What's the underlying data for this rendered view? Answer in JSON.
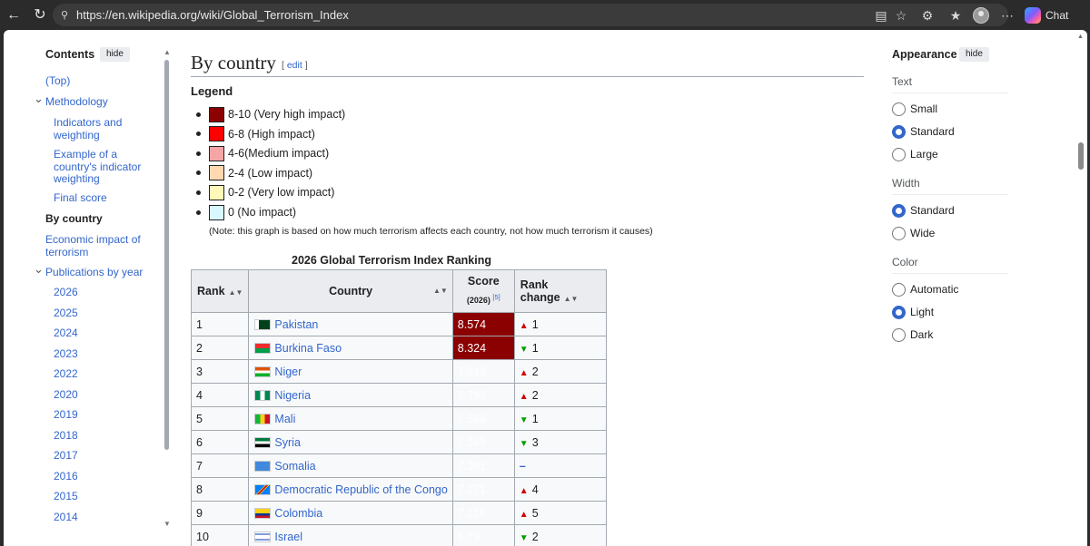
{
  "browser": {
    "url": "https://en.wikipedia.org/wiki/Global_Terrorism_Index",
    "chat_label": "Chat"
  },
  "toc": {
    "title": "Contents",
    "hide_label": "hide",
    "items": [
      {
        "label": "(Top)",
        "level": 1
      },
      {
        "label": "Methodology",
        "level": 1,
        "expandable": true
      },
      {
        "label": "Indicators and weighting",
        "level": 2
      },
      {
        "label": "Example of a country's indicator weighting",
        "level": 2
      },
      {
        "label": "Final score",
        "level": 2
      },
      {
        "label": "By country",
        "level": 1,
        "active": true
      },
      {
        "label": "Economic impact of terrorism",
        "level": 1
      },
      {
        "label": "Publications by year",
        "level": 1,
        "expandable": true
      },
      {
        "label": "2026",
        "level": 2
      },
      {
        "label": "2025",
        "level": 2
      },
      {
        "label": "2024",
        "level": 2
      },
      {
        "label": "2023",
        "level": 2
      },
      {
        "label": "2022",
        "level": 2
      },
      {
        "label": "2020",
        "level": 2
      },
      {
        "label": "2019",
        "level": 2
      },
      {
        "label": "2018",
        "level": 2
      },
      {
        "label": "2017",
        "level": 2
      },
      {
        "label": "2016",
        "level": 2
      },
      {
        "label": "2015",
        "level": 2
      },
      {
        "label": "2014",
        "level": 2
      }
    ]
  },
  "section": {
    "heading": "By country",
    "edit_open": "[ ",
    "edit_label": "edit",
    "edit_close": " ]",
    "legend_title": "Legend",
    "legend": [
      {
        "label": "8-10 (Very high impact)",
        "color": "#8b0000"
      },
      {
        "label": "6-8 (High impact)",
        "color": "#ff0000"
      },
      {
        "label": "4-6(Medium impact)",
        "color": "#f4a6a6"
      },
      {
        "label": "2-4 (Low impact)",
        "color": "#ffd8b0"
      },
      {
        "label": "0-2 (Very low impact)",
        "color": "#fff8b8"
      },
      {
        "label": "0 (No impact)",
        "color": "#d8f8ff"
      }
    ],
    "note": "(Note: this graph is based on how much terrorism affects each country, not how much terrorism it causes)"
  },
  "table": {
    "caption": "2026 Global Terrorism Index Ranking",
    "headers": {
      "rank": "Rank",
      "country": "Country",
      "score": "Score",
      "score_sub": "(2026)",
      "score_ref": "[5]",
      "rank_change": "Rank change"
    },
    "rows": [
      {
        "rank": "1",
        "country": "Pakistan",
        "flag": "pakistan",
        "score": "8.574",
        "band": "vh",
        "dir": "up",
        "change": "1"
      },
      {
        "rank": "2",
        "country": "Burkina Faso",
        "flag": "burkina",
        "score": "8.324",
        "band": "vh",
        "dir": "down",
        "change": "1"
      },
      {
        "rank": "3",
        "country": "Niger",
        "flag": "niger",
        "score": "7.816",
        "band": "h",
        "dir": "up",
        "change": "2"
      },
      {
        "rank": "4",
        "country": "Nigeria",
        "flag": "nigeria",
        "score": "7.792",
        "band": "h",
        "dir": "up",
        "change": "2"
      },
      {
        "rank": "5",
        "country": "Mali",
        "flag": "mali",
        "score": "7.586",
        "band": "h",
        "dir": "down",
        "change": "1"
      },
      {
        "rank": "6",
        "country": "Syria",
        "flag": "syria",
        "score": "7.545",
        "band": "h",
        "dir": "down",
        "change": "3"
      },
      {
        "rank": "7",
        "country": "Somalia",
        "flag": "somalia",
        "score": "7.391",
        "band": "h",
        "dir": "same",
        "change": "–"
      },
      {
        "rank": "8",
        "country": "Democratic Republic of the Congo",
        "flag": "drc",
        "score": "7.171",
        "band": "h",
        "dir": "up",
        "change": "4"
      },
      {
        "rank": "9",
        "country": "Colombia",
        "flag": "colombia",
        "score": "7.116",
        "band": "h",
        "dir": "up",
        "change": "5"
      },
      {
        "rank": "10",
        "country": "Israel",
        "flag": "israel",
        "score": "6.79",
        "band": "h",
        "dir": "down",
        "change": "2"
      }
    ]
  },
  "appearance": {
    "title": "Appearance",
    "hide_label": "hide",
    "groups": [
      {
        "label": "Text",
        "options": [
          {
            "label": "Small",
            "checked": false
          },
          {
            "label": "Standard",
            "checked": true
          },
          {
            "label": "Large",
            "checked": false
          }
        ]
      },
      {
        "label": "Width",
        "options": [
          {
            "label": "Standard",
            "checked": true
          },
          {
            "label": "Wide",
            "checked": false
          }
        ]
      },
      {
        "label": "Color",
        "options": [
          {
            "label": "Automatic",
            "checked": false
          },
          {
            "label": "Light",
            "checked": true
          },
          {
            "label": "Dark",
            "checked": false
          }
        ]
      }
    ]
  }
}
